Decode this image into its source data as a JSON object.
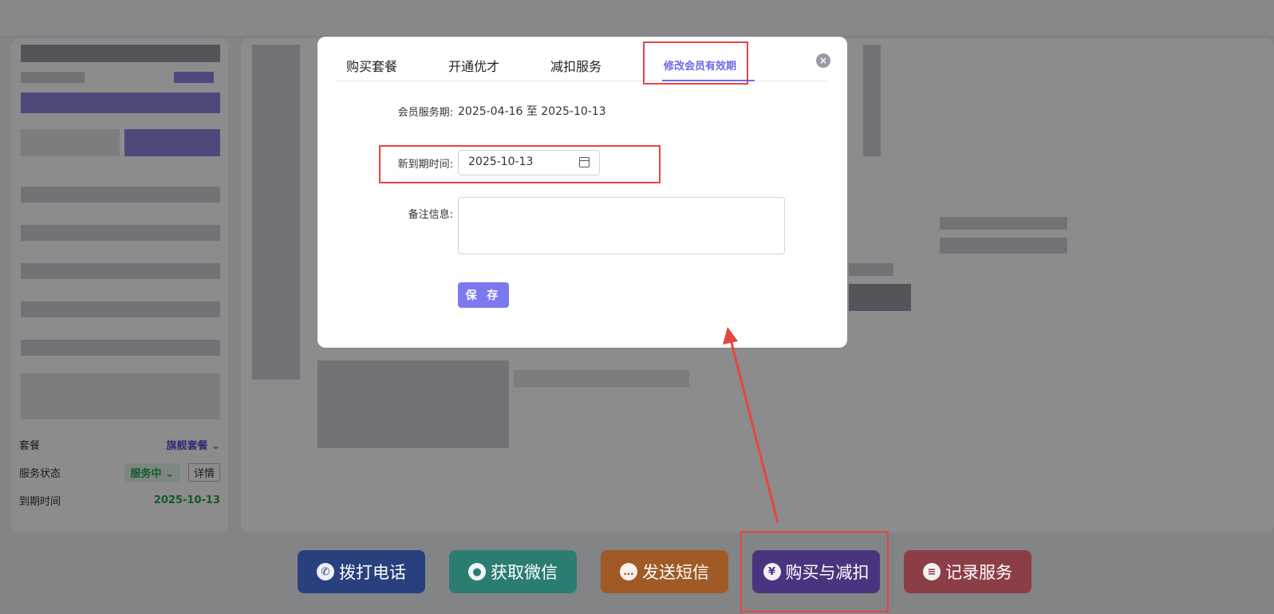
{
  "left_panel": {
    "plan_label": "套餐",
    "plan_value": "旗舰套餐",
    "status_label": "服务状态",
    "status_value": "服务中",
    "detail_button": "详情",
    "expiry_label": "到期时间",
    "expiry_value": "2025-10-13"
  },
  "modal": {
    "tabs": [
      {
        "label": "购买套餐"
      },
      {
        "label": "开通优才"
      },
      {
        "label": "减扣服务"
      },
      {
        "label": "修改会员有效期"
      }
    ],
    "service_period_label": "会员服务期:",
    "service_period_value": "2025-04-16 至 2025-10-13",
    "new_expiry_label": "新到期时间:",
    "new_expiry_value": "2025-10-13",
    "notes_label": "备注信息:",
    "save_button": "保 存"
  },
  "action_bar": {
    "call": "拨打电话",
    "wechat": "获取微信",
    "sms": "发送短信",
    "buy": "购买与减扣",
    "record": "记录服务"
  },
  "icons": {
    "call": "phone-icon",
    "wechat": "wechat-icon",
    "sms": "message-icon",
    "buy": "yuan-icon",
    "record": "clipboard-icon"
  },
  "colors": {
    "accent": "#7c79ef",
    "annotation": "#e54640"
  }
}
